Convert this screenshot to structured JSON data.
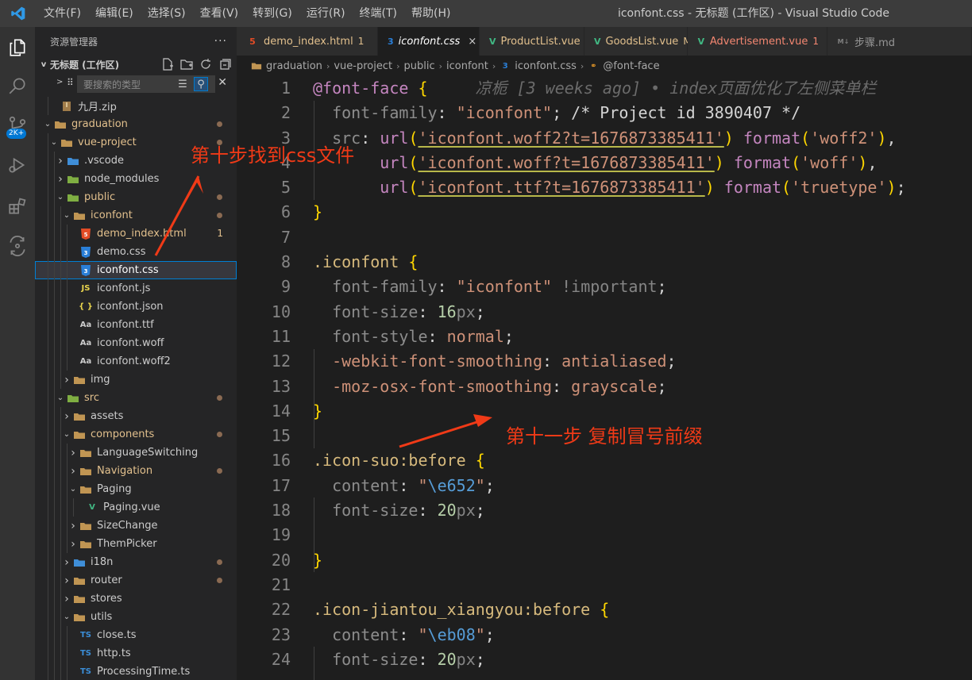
{
  "titlebar": {
    "menus": [
      "文件(F)",
      "编辑(E)",
      "选择(S)",
      "查看(V)",
      "转到(G)",
      "运行(R)",
      "终端(T)",
      "帮助(H)"
    ],
    "window_title": "iconfont.css - 无标题 (工作区) - Visual Studio Code"
  },
  "activity": {
    "badge": "2K+"
  },
  "sidebar": {
    "header": "资源管理器",
    "more": "···",
    "workspace": "无标题 (工作区)",
    "filter_placeholder": "要搜索的类型",
    "tree": [
      {
        "label": "九月.zip",
        "icon": "zip"
      },
      {
        "label": "graduation",
        "icon": "folder",
        "chev": "v",
        "dot": true
      },
      {
        "label": "vue-project",
        "icon": "folder",
        "chev": "v",
        "dot": true
      },
      {
        "label": ".vscode",
        "icon": "folder-blue",
        "chev": ">"
      },
      {
        "label": "node_modules",
        "icon": "folder-green",
        "chev": ">"
      },
      {
        "label": "public",
        "icon": "folder-green",
        "chev": "v",
        "dot": true
      },
      {
        "label": "iconfont",
        "icon": "folder",
        "chev": "v",
        "dot": true
      },
      {
        "label": "demo_index.html",
        "icon": "html",
        "badge": "1"
      },
      {
        "label": "demo.css",
        "icon": "css"
      },
      {
        "label": "iconfont.css",
        "icon": "css",
        "selected": true
      },
      {
        "label": "iconfont.js",
        "icon": "js"
      },
      {
        "label": "iconfont.json",
        "icon": "json"
      },
      {
        "label": "iconfont.ttf",
        "icon": "font"
      },
      {
        "label": "iconfont.woff",
        "icon": "font"
      },
      {
        "label": "iconfont.woff2",
        "icon": "font"
      },
      {
        "label": "img",
        "icon": "folder",
        "chev": ">"
      },
      {
        "label": "src",
        "icon": "folder-green",
        "chev": "v",
        "dot": true
      },
      {
        "label": "assets",
        "icon": "folder",
        "chev": ">"
      },
      {
        "label": "components",
        "icon": "folder",
        "chev": "v",
        "dot": true
      },
      {
        "label": "LanguageSwitching",
        "icon": "folder",
        "chev": ">"
      },
      {
        "label": "Navigation",
        "icon": "folder",
        "chev": ">",
        "dot": true
      },
      {
        "label": "Paging",
        "icon": "folder",
        "chev": "v"
      },
      {
        "label": "Paging.vue",
        "icon": "vue"
      },
      {
        "label": "SizeChange",
        "icon": "folder",
        "chev": ">"
      },
      {
        "label": "ThemPicker",
        "icon": "folder",
        "chev": ">"
      },
      {
        "label": "i18n",
        "icon": "folder-blue",
        "chev": ">",
        "dot": true
      },
      {
        "label": "router",
        "icon": "folder",
        "chev": ">",
        "dot": true
      },
      {
        "label": "stores",
        "icon": "folder",
        "chev": ">"
      },
      {
        "label": "utils",
        "icon": "folder",
        "chev": "v"
      },
      {
        "label": "close.ts",
        "icon": "ts"
      },
      {
        "label": "http.ts",
        "icon": "ts"
      },
      {
        "label": "ProcessingTime.ts",
        "icon": "ts"
      }
    ]
  },
  "tabs": [
    {
      "label": "demo_index.html",
      "icon": "html",
      "status": "1"
    },
    {
      "label": "iconfont.css",
      "icon": "css",
      "active": true,
      "close": "×"
    },
    {
      "label": "ProductList.vue",
      "icon": "vue",
      "status": "M"
    },
    {
      "label": "GoodsList.vue",
      "icon": "vue",
      "status": "M"
    },
    {
      "label": "Advertisement.vue",
      "icon": "vue",
      "status": "1"
    },
    {
      "label": "步骤.md",
      "icon": "md"
    }
  ],
  "breadcrumb": {
    "parts": [
      "graduation",
      "vue-project",
      "public",
      "iconfont",
      "iconfont.css",
      "@font-face"
    ]
  },
  "editor": {
    "line_numbers": [
      "1",
      "2",
      "3",
      "4",
      "5",
      "6",
      "7",
      "8",
      "9",
      "10",
      "11",
      "12",
      "13",
      "14",
      "15",
      "16",
      "17",
      "18",
      "19",
      "20",
      "21",
      "22",
      "23",
      "24"
    ],
    "blame": "凉栀 [3 weeks ago] • index页面优化了左侧菜单栏",
    "l1_sel": "@font-face",
    "l2": {
      "prop": "font-family",
      "val": "\"iconfont\"",
      "comment": "/* Project id 3890407 */"
    },
    "l3": {
      "prop": "src",
      "fn": "url",
      "str": "'iconfont.woff2?t=1676873385411'",
      "fmt": "format",
      "fstr": "'woff2'"
    },
    "l4": {
      "fn": "url",
      "str": "'iconfont.woff?t=1676873385411'",
      "fmt": "format",
      "fstr": "'woff'"
    },
    "l5": {
      "fn": "url",
      "str": "'iconfont.ttf?t=1676873385411'",
      "fmt": "format",
      "fstr": "'truetype'"
    },
    "l8_sel": ".iconfont",
    "l9": {
      "prop": "font-family",
      "val": "\"iconfont\"",
      "imp": "!important"
    },
    "l10": {
      "prop": "font-size",
      "num": "16",
      "unit": "px"
    },
    "l11": {
      "prop": "font-style",
      "val": "normal"
    },
    "l12": {
      "prop": "-webkit-font-smoothing",
      "val": "antialiased"
    },
    "l13": {
      "prop": "-moz-osx-font-smoothing",
      "val": "grayscale"
    },
    "l16_sel": ".icon-suo:before",
    "l17": {
      "prop": "content",
      "q1": "\"",
      "esc": "\\e652",
      "q2": "\""
    },
    "l18": {
      "prop": "font-size",
      "num": "20",
      "unit": "px"
    },
    "l22_sel": ".icon-jiantou_xiangyou:before",
    "l23": {
      "prop": "content",
      "q1": "\"",
      "esc": "\\eb08",
      "q2": "\""
    },
    "l24": {
      "prop": "font-size",
      "num": "20",
      "unit": "px"
    }
  },
  "annotations": {
    "step10": "第十步找到css文件",
    "step11": "第十一步 复制冒号前缀"
  },
  "colors": {
    "accent": "#007acc",
    "annotation": "#f03a17"
  }
}
